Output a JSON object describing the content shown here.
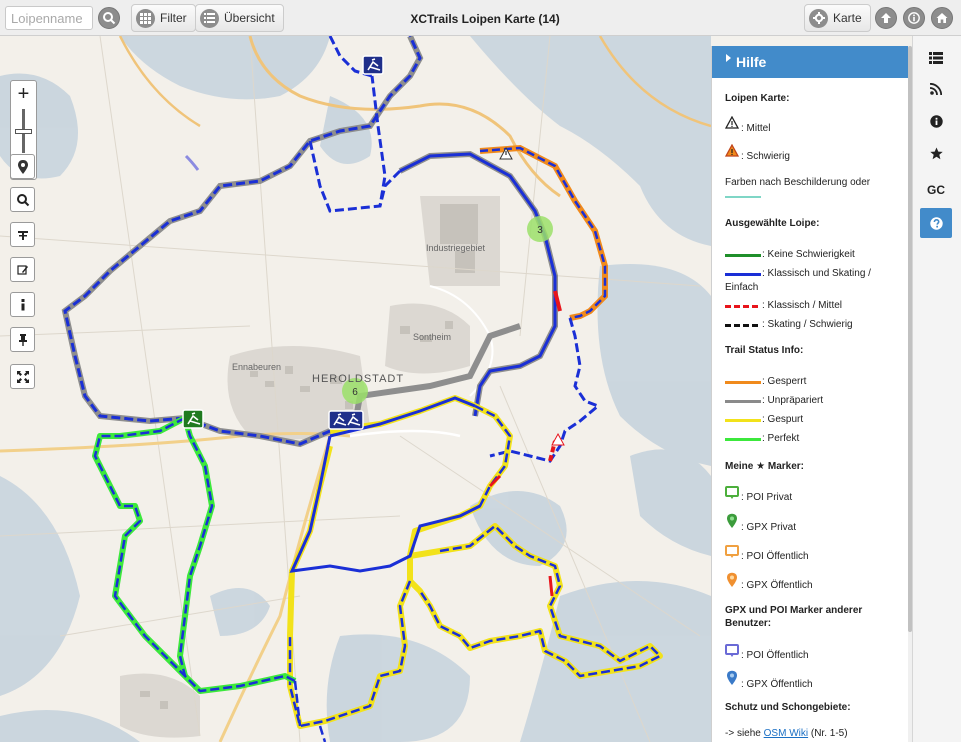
{
  "topbar": {
    "search_placeholder": "Loipenname",
    "filter_label": "Filter",
    "overview_label": "Übersicht",
    "title": "XCTrails Loipen Karte  (14)",
    "map_label": "Karte"
  },
  "map": {
    "labels": {
      "town": "HEROLDSTADT",
      "village": "Ennabeuren",
      "district": "Sontheim",
      "industry": "Industriegebiet"
    },
    "clusters": [
      "3",
      "6"
    ],
    "zoom_in": "+",
    "zoom_out": "−"
  },
  "sidebar": {
    "gc_label": "GC"
  },
  "help": {
    "header": "Hilfe",
    "map_title": "Loipen Karte:",
    "difficulty_medium": ": Mittel",
    "difficulty_hard": ": Schwierig",
    "colors_note": "Farben nach Beschilderung oder",
    "selected_title": "Ausgewählte Loipe:",
    "selected": [
      {
        "label": ": Keine Schwierigkeit",
        "color": "#1f8f2a",
        "dash": false
      },
      {
        "label": ": Klassisch und Skating /",
        "label2": "Einfach",
        "color": "#1a2fd6",
        "dash": false
      },
      {
        "label": ": Klassisch / Mittel",
        "color": "#e8141b",
        "dash": true
      },
      {
        "label": ": Skating / Schwierig",
        "color": "#111111",
        "dash": true
      }
    ],
    "status_title": "Trail Status Info:",
    "status": [
      {
        "label": ": Gesperrt",
        "color": "#f08a1c"
      },
      {
        "label": ": Unpräpariert",
        "color": "#8a8a8a"
      },
      {
        "label": ": Gespurt",
        "color": "#f2e21a"
      },
      {
        "label": ": Perfekt",
        "color": "#3ce83c"
      }
    ],
    "my_markers_title": "Meine ★ Marker:",
    "my_markers": [
      {
        "label": ": POI Privat",
        "color": "#4caf3c",
        "kind": "poi"
      },
      {
        "label": ": GPX Privat",
        "color": "#3c9c3c",
        "kind": "gpx"
      },
      {
        "label": ": POI Öffentlich",
        "color": "#f0a040",
        "kind": "poi"
      },
      {
        "label": ": GPX Öffentlich",
        "color": "#f09030",
        "kind": "gpx"
      }
    ],
    "other_markers_title": "GPX und POI Marker anderer",
    "other_markers_title2": "Benutzer:",
    "other_markers": [
      {
        "label": ": POI Öffentlich",
        "color": "#6a6ad6",
        "kind": "poi"
      },
      {
        "label": ": GPX Öffentlich",
        "color": "#3a7ac8",
        "kind": "gpx"
      }
    ],
    "protect_title": "Schutz und Schongebiete:",
    "protect_prefix": "-> siehe ",
    "protect_link": "OSM Wiki",
    "protect_suffix": " (Nr. 1-5)"
  }
}
